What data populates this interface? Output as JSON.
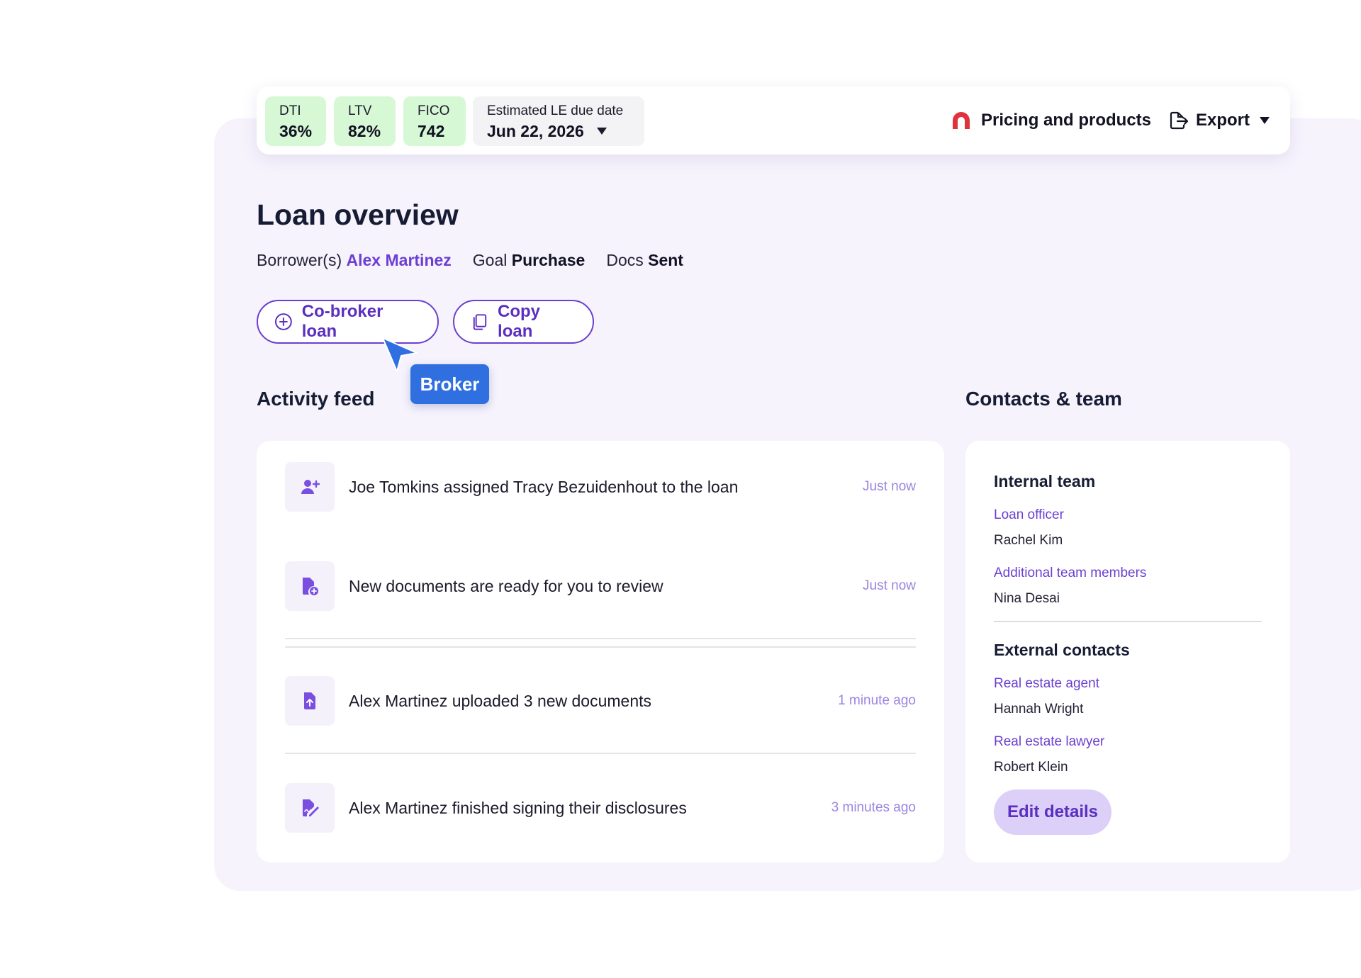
{
  "metrics": {
    "dti": {
      "label": "DTI",
      "value": "36%"
    },
    "ltv": {
      "label": "LTV",
      "value": "82%"
    },
    "fico": {
      "label": "FICO",
      "value": "742"
    },
    "le_due": {
      "label": "Estimated LE due date",
      "value": "Jun 22, 2026"
    }
  },
  "toolbar": {
    "pricing_label": "Pricing and products",
    "export_label": "Export"
  },
  "overview": {
    "title": "Loan overview",
    "borrower_key": "Borrower(s)",
    "borrower_value": "Alex Martinez",
    "goal_key": "Goal",
    "goal_value": "Purchase",
    "docs_key": "Docs",
    "docs_value": "Sent",
    "cobroker_label": "Co-broker loan",
    "copy_label": "Copy loan",
    "tooltip": "Broker"
  },
  "activity": {
    "title": "Activity feed",
    "items": [
      {
        "text": "Joe Tomkins assigned Tracy Bezuidenhout to the loan",
        "time": "Just now",
        "icon": "user-plus-icon"
      },
      {
        "text": "New documents are ready for you to review",
        "time": "Just now",
        "icon": "document-add-icon"
      },
      {
        "text": "Alex Martinez uploaded 3 new documents",
        "time": "1 minute ago",
        "icon": "document-upload-icon"
      },
      {
        "text": "Alex Martinez finished signing their disclosures",
        "time": "3 minutes ago",
        "icon": "document-sign-icon"
      }
    ]
  },
  "contacts": {
    "title": "Contacts & team",
    "internal_title": "Internal team",
    "loan_officer_role": "Loan officer",
    "loan_officer_name": "Rachel Kim",
    "additional_role": "Additional team members",
    "additional_name": "Nina Desai",
    "external_title": "External contacts",
    "agent_role": "Real estate agent",
    "agent_name": "Hannah Wright",
    "lawyer_role": "Real estate lawyer",
    "lawyer_name": "Robert Klein",
    "edit_label": "Edit details"
  },
  "colors": {
    "accent_purple": "#6c3fd1",
    "metric_green": "#d7f8d4",
    "tooltip_blue": "#2f6fe0",
    "canvas_lavender": "#f6f3fd"
  }
}
